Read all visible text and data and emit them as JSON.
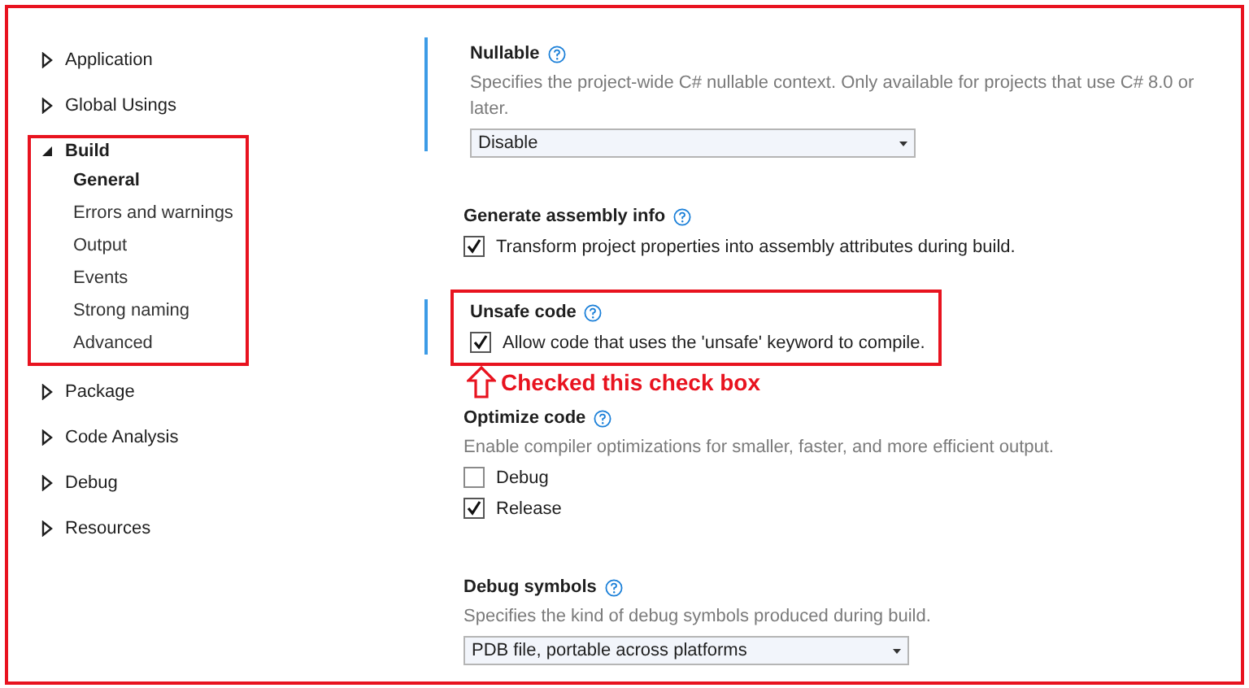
{
  "sidebar": {
    "items": [
      {
        "label": "Application",
        "expanded": false,
        "highlighted": false
      },
      {
        "label": "Global Usings",
        "expanded": false,
        "highlighted": false
      },
      {
        "label": "Build",
        "expanded": true,
        "highlighted": true,
        "children": [
          {
            "label": "General",
            "selected": true
          },
          {
            "label": "Errors and warnings",
            "selected": false
          },
          {
            "label": "Output",
            "selected": false
          },
          {
            "label": "Events",
            "selected": false
          },
          {
            "label": "Strong naming",
            "selected": false
          },
          {
            "label": "Advanced",
            "selected": false
          }
        ]
      },
      {
        "label": "Package",
        "expanded": false,
        "highlighted": false
      },
      {
        "label": "Code Analysis",
        "expanded": false,
        "highlighted": false
      },
      {
        "label": "Debug",
        "expanded": false,
        "highlighted": false
      },
      {
        "label": "Resources",
        "expanded": false,
        "highlighted": false
      }
    ]
  },
  "sections": [
    {
      "kind": "dropdown",
      "title": "Nullable",
      "modified": true,
      "highlighted": false,
      "description": "Specifies the project-wide C# nullable context. Only available for projects that use C# 8.0 or later.",
      "value": "Disable"
    },
    {
      "kind": "checkbox",
      "title": "Generate assembly info",
      "modified": false,
      "highlighted": false,
      "options": [
        {
          "label": "Transform project properties into assembly attributes during build.",
          "checked": true
        }
      ]
    },
    {
      "kind": "checkbox",
      "title": "Unsafe code",
      "modified": true,
      "highlighted": true,
      "options": [
        {
          "label": "Allow code that uses the 'unsafe' keyword to compile.",
          "checked": true
        }
      ],
      "annotation": "Checked this check box"
    },
    {
      "kind": "checkbox",
      "title": "Optimize code",
      "modified": false,
      "highlighted": false,
      "description": "Enable compiler optimizations for smaller, faster, and more efficient output.",
      "options": [
        {
          "label": "Debug",
          "checked": false
        },
        {
          "label": "Release",
          "checked": true
        }
      ]
    },
    {
      "kind": "dropdown",
      "title": "Debug symbols",
      "modified": false,
      "highlighted": false,
      "description": "Specifies the kind of debug symbols produced during build.",
      "value": "PDB file, portable across platforms"
    }
  ]
}
